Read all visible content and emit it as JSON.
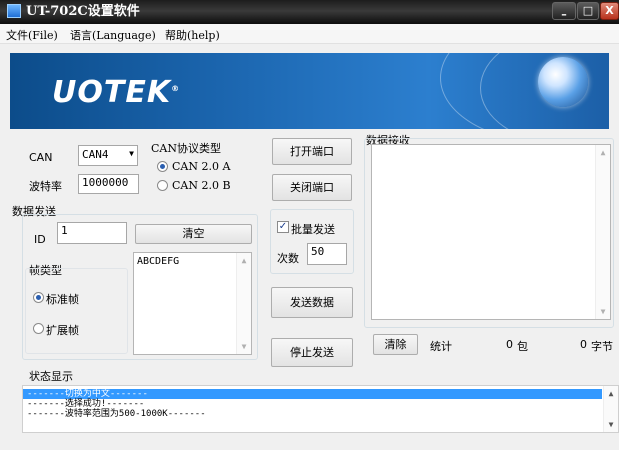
{
  "window": {
    "title": "UT-702C设置软件"
  },
  "titlebar_buttons": {
    "minimize": "–",
    "maximize": "□",
    "close": "X"
  },
  "menu": [
    {
      "label": "文件(File)"
    },
    {
      "label": "语言(Language)"
    },
    {
      "label": "帮助(help)"
    }
  ],
  "banner": {
    "logo_text": "UOTEK",
    "logo_registered": "®"
  },
  "port": {
    "can_label": "CAN",
    "can_value": "CAN4",
    "baud_label": "波特率",
    "baud_value": "1000000"
  },
  "protocol": {
    "title": "CAN协议类型",
    "options": [
      {
        "label": "CAN 2.0 A",
        "selected": true
      },
      {
        "label": "CAN 2.0 B",
        "selected": false
      }
    ]
  },
  "buttons": {
    "open_port": "打开端口",
    "close_port": "关闭端口",
    "send_data": "发送数据",
    "stop_send": "停止发送",
    "clear_send": "清空",
    "clear_receive": "清除"
  },
  "send": {
    "section_label": "数据发送",
    "id_label": "ID",
    "id_value": "1",
    "frame_title": "帧类型",
    "frame_options": [
      {
        "label": "标准帧",
        "selected": true
      },
      {
        "label": "扩展帧",
        "selected": false
      }
    ],
    "data_text": "ABCDEFG"
  },
  "batch": {
    "checkbox_label": "批量发送",
    "checked": true,
    "count_label": "次数",
    "count_value": "50"
  },
  "receive": {
    "section_label": "数据接收",
    "stats_label": "统计",
    "packets_value": "0",
    "packets_unit": "包",
    "bytes_value": "0",
    "bytes_unit": "字节"
  },
  "status": {
    "section_label": "状态显示",
    "lines": [
      {
        "text": "-------切换为中文-------",
        "selected": true
      },
      {
        "text": "-------选择成功!-------",
        "selected": false
      },
      {
        "text": "-------波特率范围为500-1000K-------",
        "selected": false
      }
    ]
  },
  "colors": {
    "banner_dark": "#0c4c8a",
    "banner_light": "#2c7fcf",
    "selection": "#3399ff"
  }
}
